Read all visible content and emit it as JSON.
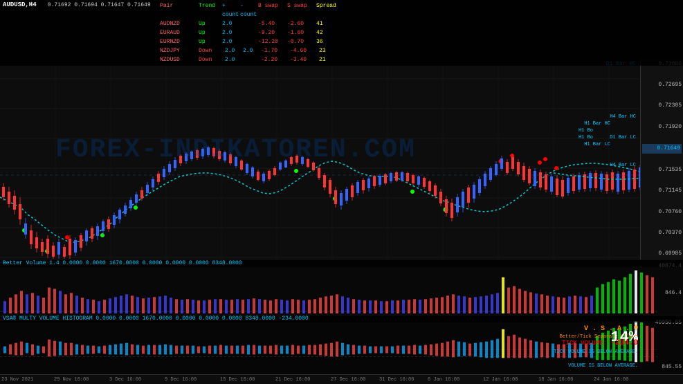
{
  "chart": {
    "symbol": "AUDUSD,H4",
    "ohlc": "0.71692 0.71694 0.71647 0.71649",
    "watermark": "FOREX-INDIKATOREN.COM",
    "prices": {
      "p1": "0.73080",
      "p2": "0.72695",
      "p3": "0.72305",
      "p4": "0.71920",
      "p5": "0.71649",
      "p6": "0.71535",
      "p7": "0.71145",
      "p8": "0.70760",
      "p9": "0.70370",
      "p10": "0.69985"
    },
    "labels": {
      "d1_bar_hc": "D1 Bar HC",
      "h4_bar_hc": "H4 Bar HC",
      "h1_bar_hc": "H1 Bar HC",
      "d1_bar_lc": "D1 Bar LC",
      "h4_bar_lc": "H4 Bar LC",
      "h1_bar_lc": "H1 Bar LC",
      "h1_bo": "H1 Bo",
      "h1_bo2": "H1 Bo"
    }
  },
  "pairs": {
    "header": {
      "pair": "Pair",
      "trend": "Trend",
      "plus_count": "+ count",
      "minus_count": "- count",
      "b_swap": "B swap",
      "s_swap": "S swap",
      "spread": "Spread"
    },
    "rows": [
      {
        "name": "AUDNZD",
        "trend": "Up",
        "plus": "2.0",
        "minus": "",
        "b_swap": "-5.40",
        "s_swap": "-2.60",
        "spread": "41"
      },
      {
        "name": "EURAUD",
        "trend": "Up",
        "plus": "2.0",
        "minus": "",
        "b_swap": "-9.20",
        "s_swap": "-1.60",
        "spread": "42"
      },
      {
        "name": "EURNZD",
        "trend": "Up",
        "plus": "2.0",
        "minus": "",
        "b_swap": "-12.20",
        "s_swap": "-0.70",
        "spread": "36"
      },
      {
        "name": "NZDJPY",
        "trend": "Down",
        "plus": "2.0",
        "minus": "2.0",
        "b_swap": "-1.70",
        "s_swap": "-4.60",
        "spread": "23"
      },
      {
        "name": "NZDUSD",
        "trend": "Down",
        "plus": "2.0",
        "minus": "",
        "b_swap": "-2.20",
        "s_swap": "-3.40",
        "spread": "21"
      }
    ]
  },
  "volume": {
    "info": "Better Volume 1.4 0.0000 0.0000 1670.0000 0.0000 0.0000 0.0000 8348.0000",
    "scale1": "40874.4",
    "scale2": "846.4"
  },
  "vsa": {
    "info": "VSA® MULTY VOLUME HISTOGRAM 0.0000 0.0000 1670.0000 0.0000 0.0000 0.0000 8348.0000 -234.0000",
    "vsa_label": "V . S . A . ®",
    "sub_label": "Better/Tick Separate Volume",
    "tick_volume_label": "TICK VOLUME:",
    "tick_volume_value": "-234.0",
    "tick_below": "TICK VOLUME IS BELOW AVERAGE.",
    "vol_below": "VOLUME IS BELOW AVERAGE.",
    "pct": "14%",
    "scale1": "40950.55",
    "scale2": "845.55"
  },
  "timeaxis": {
    "labels": [
      "23 Nov 2021",
      "29 Nov 16:00",
      "3 Dec 16:00",
      "9 Dec 16:00",
      "15 Dec 16:00",
      "21 Dec 16:00",
      "27 Dec 16:00",
      "31 Dec 16:00",
      "6 Jan 16:00",
      "12 Jan 16:00",
      "18 Jan 16:00",
      "24 Jan 16:00"
    ]
  }
}
